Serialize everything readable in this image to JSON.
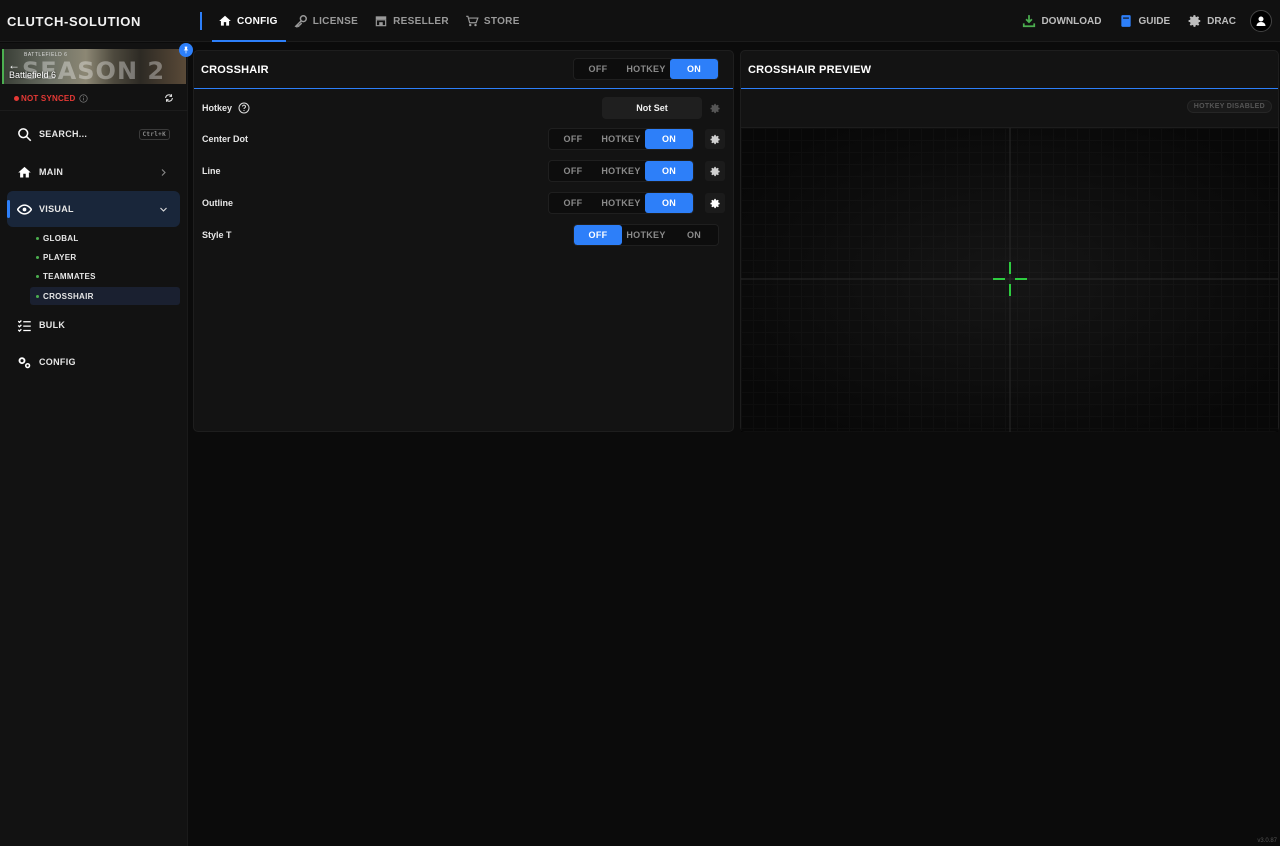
{
  "app": {
    "brand": "CLUTCH-SOLUTION",
    "version": "v3.0.87"
  },
  "topnav": [
    {
      "label": "CONFIG",
      "icon": "home-icon",
      "active": true
    },
    {
      "label": "LICENSE",
      "icon": "key-icon",
      "active": false
    },
    {
      "label": "RESELLER",
      "icon": "store-icon",
      "active": false
    },
    {
      "label": "STORE",
      "icon": "cart-icon",
      "active": false
    }
  ],
  "topright": {
    "download": "DOWNLOAD",
    "guide": "GUIDE",
    "user": "DRAC"
  },
  "sidebar": {
    "game": {
      "name": "Battlefield 6",
      "banner_small": "BATTLEFIELD 6",
      "banner_text": "SEASON 2"
    },
    "sync_status": "NOT SYNCED",
    "search": {
      "label": "SEARCH...",
      "shortcut": "Ctrl+K"
    },
    "items": [
      {
        "label": "MAIN",
        "icon": "home-icon"
      },
      {
        "label": "VISUAL",
        "icon": "eye-icon",
        "active": true
      },
      {
        "label": "BULK",
        "icon": "checklist-icon"
      },
      {
        "label": "CONFIG",
        "icon": "gears-icon"
      }
    ],
    "sub_items": [
      {
        "label": "GLOBAL"
      },
      {
        "label": "PLAYER"
      },
      {
        "label": "TEAMMATES"
      },
      {
        "label": "CROSSHAIR",
        "active": true
      }
    ]
  },
  "crosshair_panel": {
    "title": "CROSSHAIR",
    "toggle": {
      "options": [
        "OFF",
        "HOTKEY",
        "ON"
      ],
      "selected": "ON"
    },
    "hotkey": {
      "label": "Hotkey",
      "value": "Not Set"
    },
    "rows": [
      {
        "label": "Center Dot",
        "options": [
          "OFF",
          "HOTKEY",
          "ON"
        ],
        "selected": "ON"
      },
      {
        "label": "Line",
        "options": [
          "OFF",
          "HOTKEY",
          "ON"
        ],
        "selected": "ON"
      },
      {
        "label": "Outline",
        "options": [
          "OFF",
          "HOTKEY",
          "ON"
        ],
        "selected": "ON"
      },
      {
        "label": "Style T",
        "options": [
          "OFF",
          "HOTKEY",
          "ON"
        ],
        "selected": "OFF"
      }
    ]
  },
  "preview_panel": {
    "title": "CROSSHAIR PREVIEW",
    "badge": "HOTKEY DISABLED",
    "crosshair_color": "#2ecc40"
  },
  "colors": {
    "accent": "#2d7ff9",
    "status_red": "#e53935",
    "green": "#4caf50"
  }
}
